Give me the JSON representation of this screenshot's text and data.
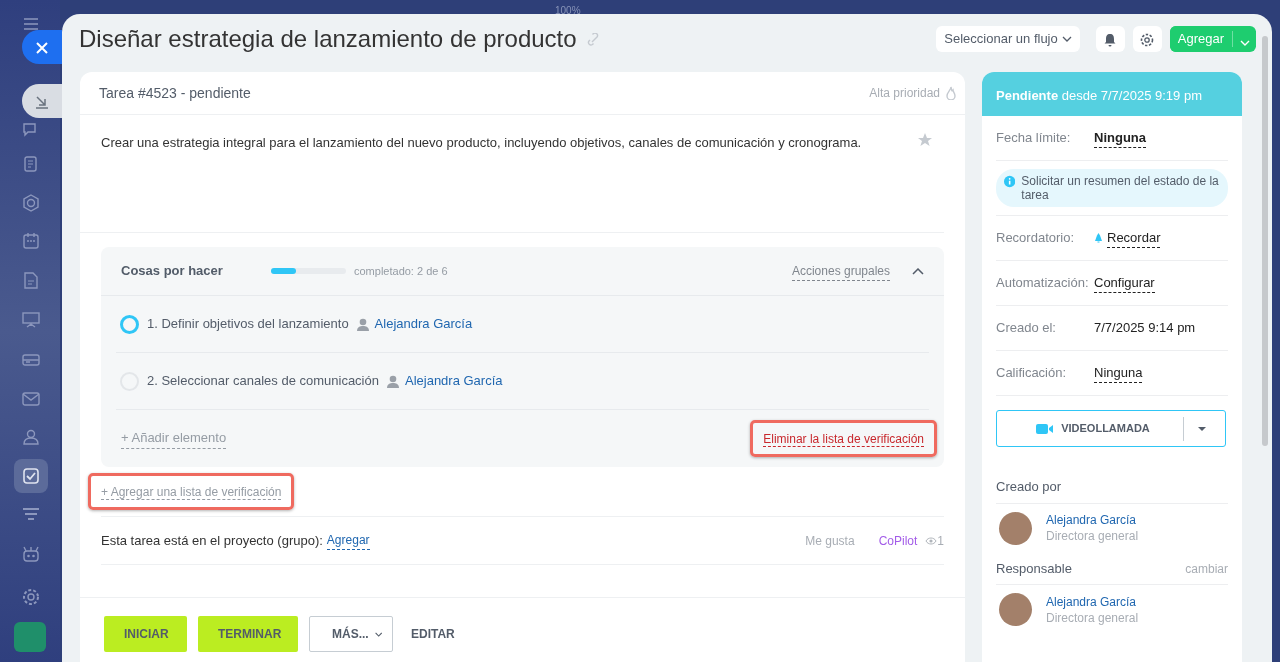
{
  "backdrop": {
    "zoom_label": "100%"
  },
  "sidebar": {
    "items": [
      {
        "selected": false
      },
      {
        "selected": false
      },
      {
        "selected": false
      },
      {
        "selected": false
      },
      {
        "selected": false
      },
      {
        "selected": false
      },
      {
        "selected": false
      },
      {
        "selected": false
      },
      {
        "selected": false
      },
      {
        "selected": true
      },
      {
        "selected": false
      },
      {
        "selected": false
      },
      {
        "selected": false
      }
    ]
  },
  "title": "Diseñar estrategia de lanzamiento de producto",
  "toolbar": {
    "flow_select": "Seleccionar un flujo",
    "add_button": "Agregar"
  },
  "task": {
    "header": "Tarea #4523 - pendiente",
    "priority": "Alta prioridad",
    "starred": false,
    "description": "Crear una estrategia integral para el lanzamiento del nuevo producto, incluyendo objetivos, canales de comunicación y cronograma."
  },
  "checklist": {
    "title": "Cosas por hacer",
    "level": 0.33,
    "progress_text": "completado: 2 de 6",
    "group_actions": "Acciones grupales",
    "expanded": true,
    "items": [
      {
        "text": "1. Definir objetivos del lanzamiento",
        "assignee": "Alejandra García",
        "highlighted": true
      },
      {
        "text": "2. Seleccionar canales de comunicación",
        "assignee": "Alejandra García",
        "highlighted": false
      }
    ],
    "add_item": "+ Añadir elemento",
    "delete": {
      "label": "Eliminar la lista de verificación",
      "highlighted": true
    }
  },
  "add_checklist": {
    "label": "+ Agregar una lista de verificación",
    "highlighted": true
  },
  "project": {
    "label": "Esta tarea está en el proyecto (grupo):",
    "link": "Agregar",
    "like": "Me gusta",
    "copilot": "CoPilot",
    "views": "1"
  },
  "actions": [
    {
      "label": "INICIAR",
      "kind": "primary"
    },
    {
      "label": "TERMINAR",
      "kind": "primary"
    },
    {
      "label": "MÁS...",
      "kind": "dropdown"
    },
    {
      "label": "EDITAR",
      "kind": "link"
    }
  ],
  "status": {
    "state": "Pendiente",
    "since": "desde 7/7/2025 9:19 pm"
  },
  "fields": [
    {
      "kind": "link",
      "label": "Fecha límite:",
      "value": "Ninguna"
    },
    {
      "kind": "info",
      "text": "Solicitar un resumen del estado de la tarea"
    },
    {
      "kind": "reminder",
      "label": "Recordatorio:",
      "value": "Recordar"
    },
    {
      "kind": "link",
      "label": "Automatización:",
      "value": "Configurar"
    },
    {
      "kind": "plain",
      "label": "Creado el:",
      "value": "7/7/2025 9:14 pm"
    },
    {
      "kind": "link",
      "label": "Calificación:",
      "value": "Ninguna"
    }
  ],
  "video_call": "VIDEOLLAMADA",
  "people": [
    {
      "heading": "Creado por",
      "name": "Alejandra García",
      "role": "Directora general"
    },
    {
      "heading": "Responsable",
      "action": "cambiar",
      "name": "Alejandra García",
      "role": "Directora general"
    }
  ]
}
